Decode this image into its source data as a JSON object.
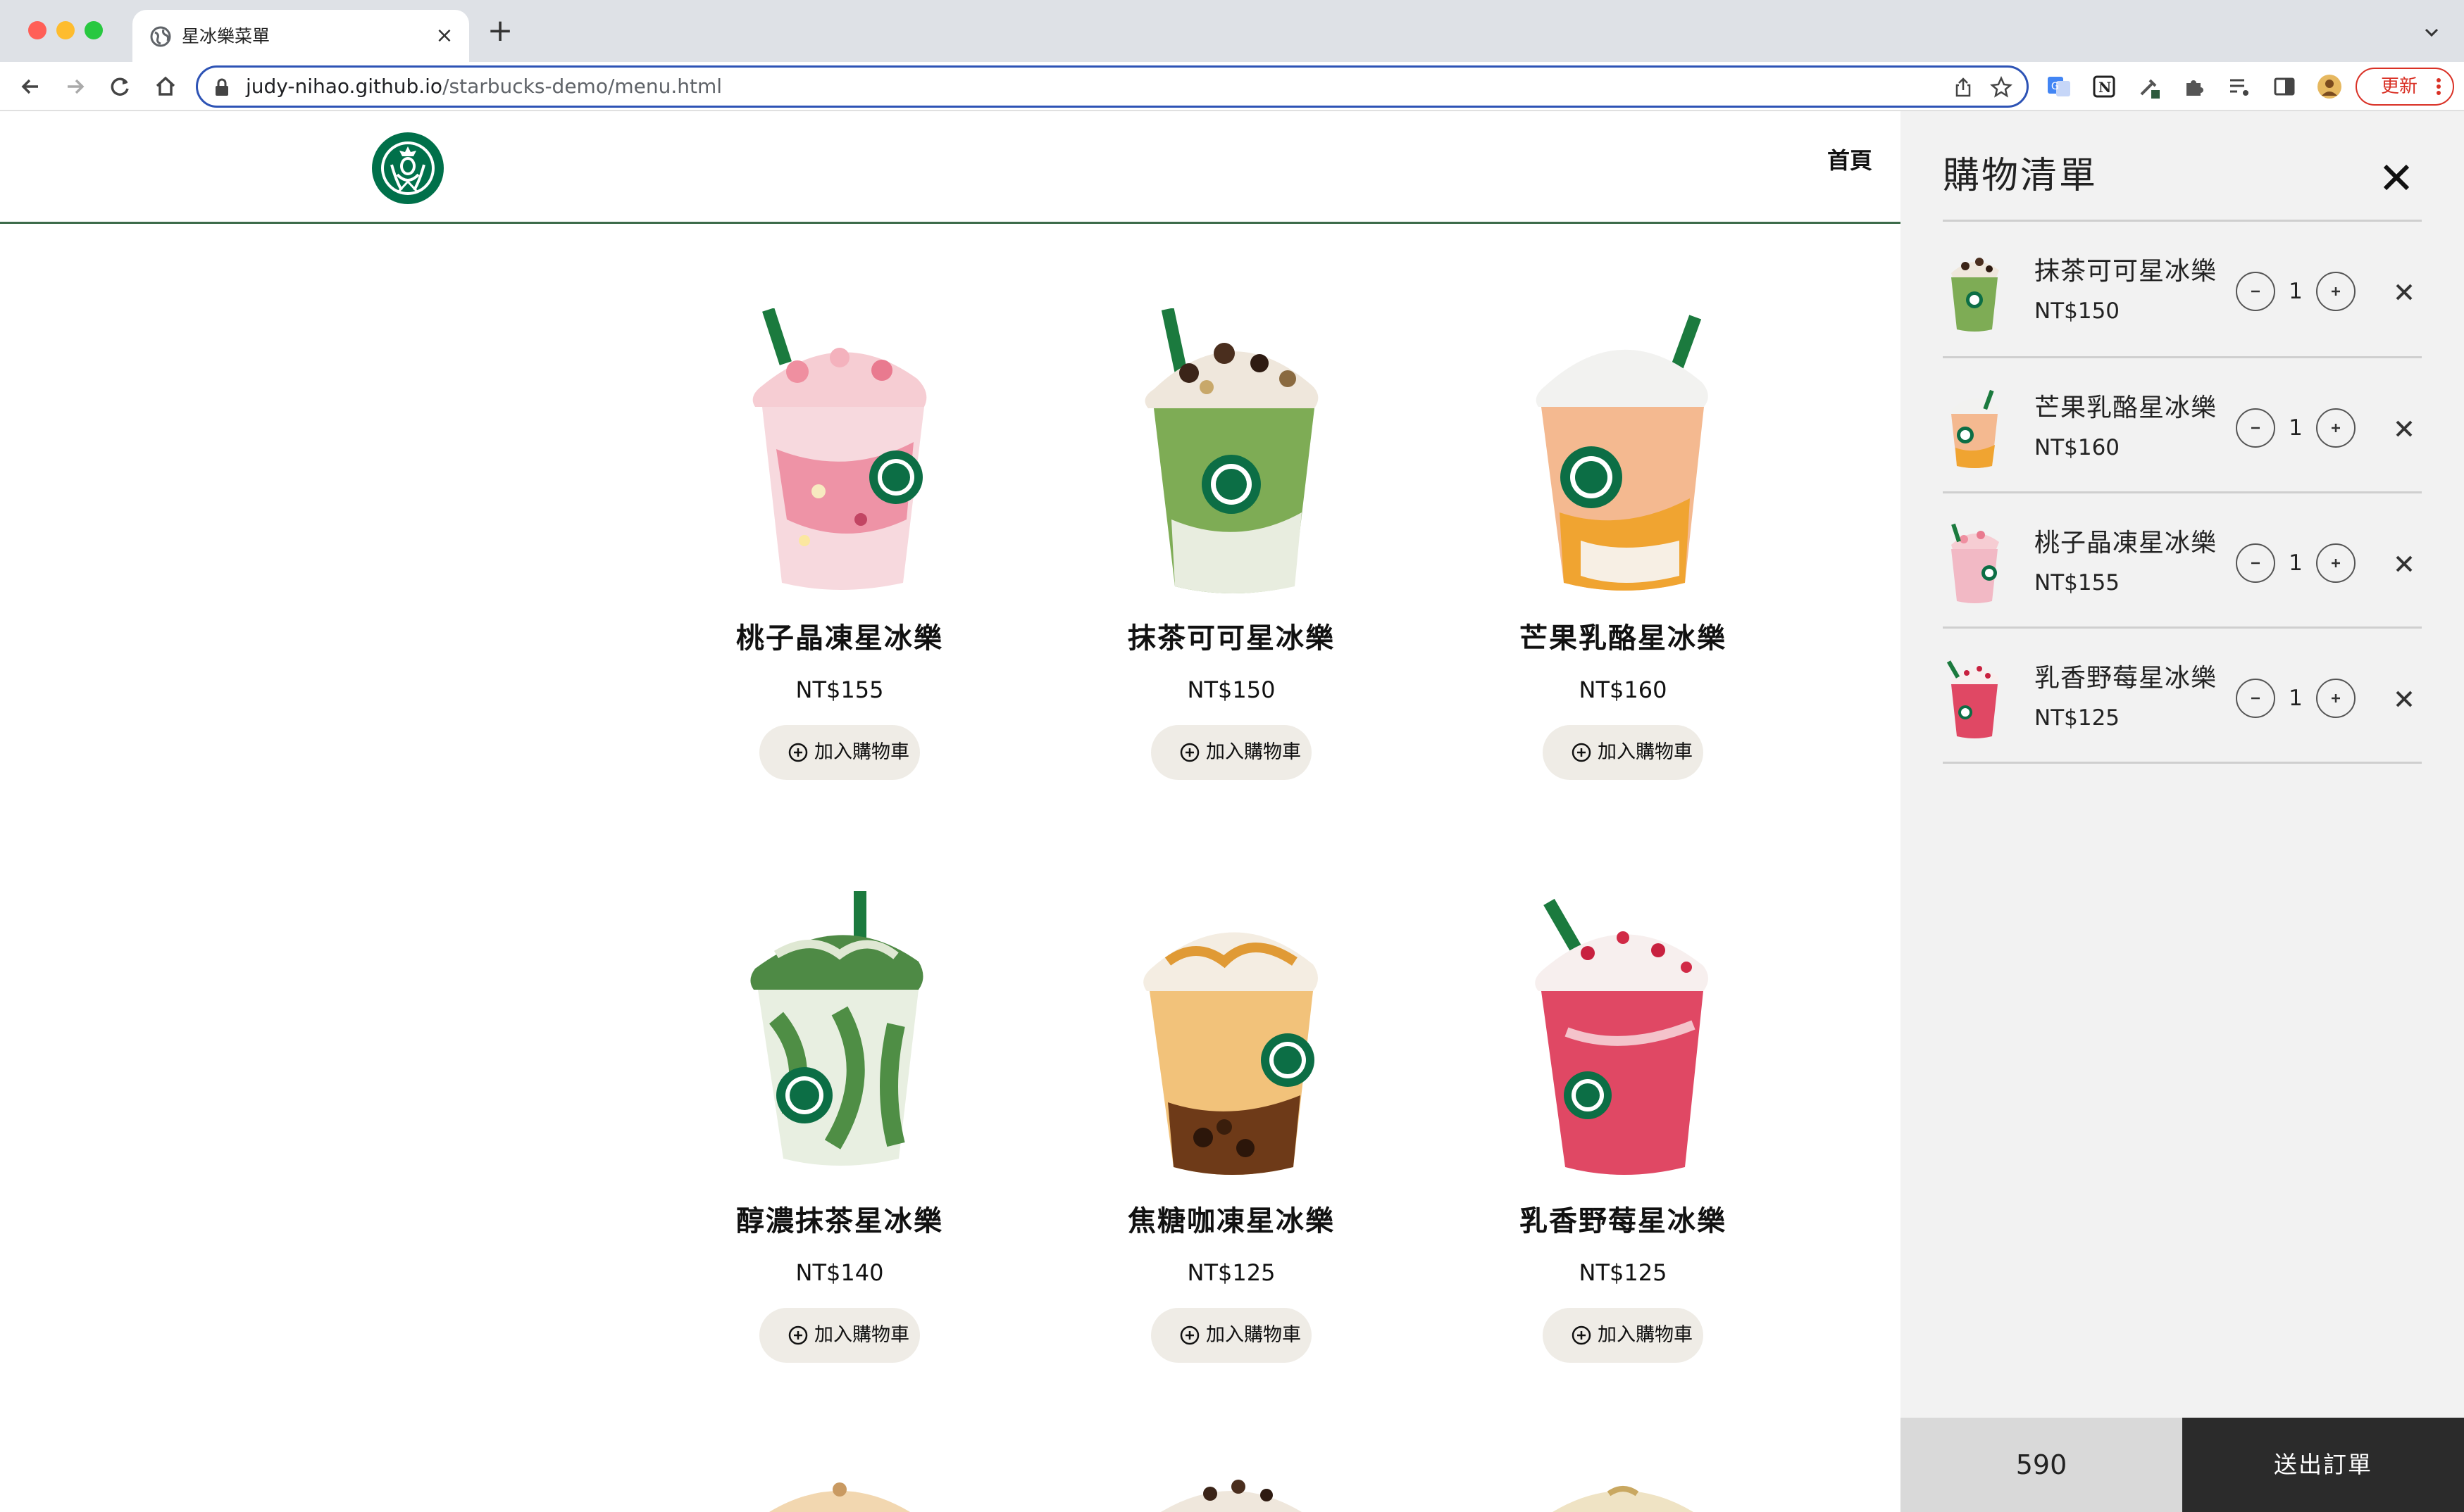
{
  "browser": {
    "tab_title": "星冰樂菜單",
    "url_host": "judy-nihao.github.io",
    "url_path": "/starbucks-demo/menu.html",
    "update_label": "更新",
    "accent_color": "#2d53b5"
  },
  "site": {
    "nav_home": "首頁",
    "brand_color": "#00704a"
  },
  "menu": {
    "add_label": "加入購物車",
    "items": [
      {
        "name": "桃子晶凍星冰樂",
        "price": "NT$155",
        "theme": "peach"
      },
      {
        "name": "抹茶可可星冰樂",
        "price": "NT$150",
        "theme": "matcha-cocoa"
      },
      {
        "name": "芒果乳酪星冰樂",
        "price": "NT$160",
        "theme": "mango"
      },
      {
        "name": "醇濃抹茶星冰樂",
        "price": "NT$140",
        "theme": "matcha"
      },
      {
        "name": "焦糖咖凍星冰樂",
        "price": "NT$125",
        "theme": "caramel"
      },
      {
        "name": "乳香野莓星冰樂",
        "price": "NT$125",
        "theme": "berry"
      }
    ]
  },
  "cart": {
    "title": "購物清單",
    "items": [
      {
        "name": "抹茶可可星冰樂",
        "price": "NT$150",
        "qty": "1"
      },
      {
        "name": "芒果乳酪星冰樂",
        "price": "NT$160",
        "qty": "1"
      },
      {
        "name": "桃子晶凍星冰樂",
        "price": "NT$155",
        "qty": "1"
      },
      {
        "name": "乳香野莓星冰樂",
        "price": "NT$125",
        "qty": "1"
      }
    ],
    "total": "590",
    "submit_label": "送出訂單"
  }
}
